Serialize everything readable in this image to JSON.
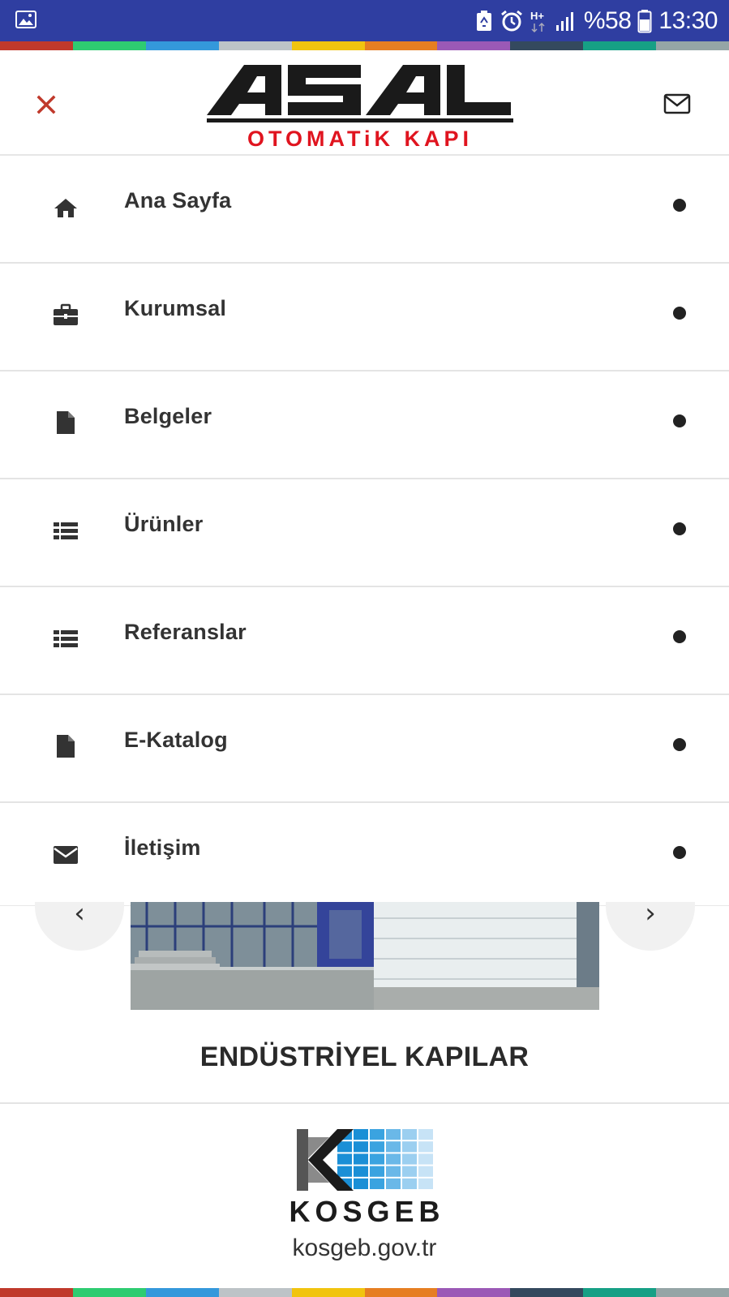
{
  "status_bar": {
    "battery_text": "%58",
    "time": "13:30",
    "network": "H+",
    "icons": [
      "gallery-icon",
      "battery-saver-icon",
      "alarm-icon",
      "network-h-plus-icon",
      "signal-icon",
      "battery-icon"
    ]
  },
  "stripe_colors": [
    "#c0392b",
    "#2ecc71",
    "#3498db",
    "#bdc3c7",
    "#f1c40f",
    "#e67e22",
    "#9b59b6",
    "#34495e",
    "#16a085",
    "#95a5a6"
  ],
  "header": {
    "logo_main": "ASAL",
    "logo_sub": "OTOMATiK KAPI",
    "close_icon": "close-icon",
    "mail_icon": "mail-icon",
    "accent_color": "#c0392b"
  },
  "menu": {
    "items": [
      {
        "label": "Ana Sayfa",
        "icon": "home-icon"
      },
      {
        "label": "Kurumsal",
        "icon": "briefcase-icon"
      },
      {
        "label": "Belgeler",
        "icon": "document-icon"
      },
      {
        "label": "Ürünler",
        "icon": "list-icon"
      },
      {
        "label": "Referanslar",
        "icon": "list-icon"
      },
      {
        "label": "E-Katalog",
        "icon": "document-icon"
      },
      {
        "label": "İletişim",
        "icon": "envelope-icon"
      }
    ]
  },
  "slider": {
    "prev_label": "‹",
    "next_label": "›"
  },
  "section": {
    "title": "ENDÜSTRİYEL KAPILAR"
  },
  "footer": {
    "kosgeb_name": "KOSGEB",
    "kosgeb_url": "kosgeb.gov.tr"
  }
}
